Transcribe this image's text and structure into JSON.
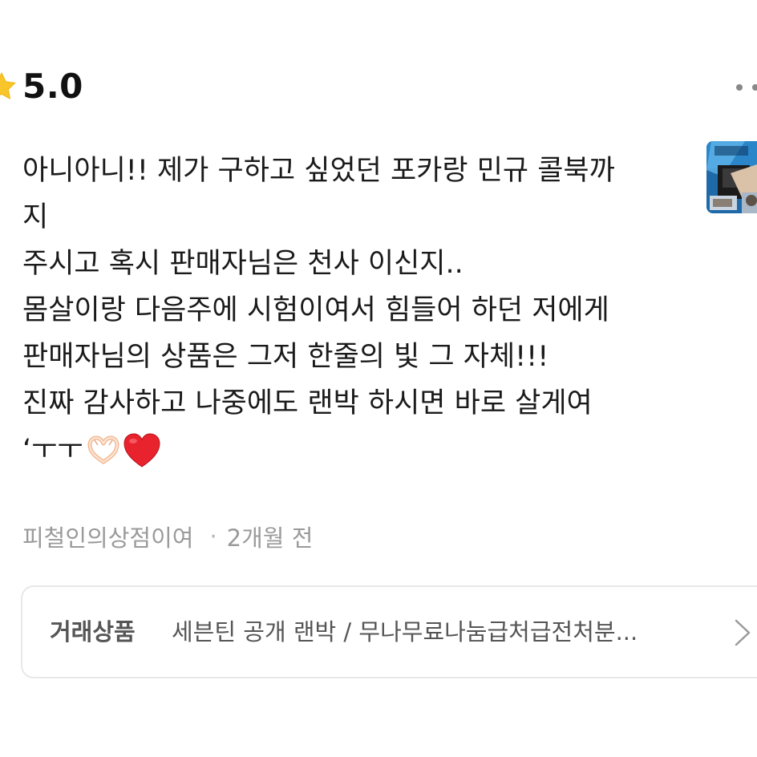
{
  "review": {
    "rating": "5.0",
    "lines": [
      "아니아니!! 제가 구하고 싶었던 포카랑 민규 콜북까",
      "지",
      "주시고 혹시 판매자님은 천사 이신지..",
      "몸살이랑 다음주에 시험이여서 힘들어 하던 저에게",
      "판매자님의 상품은 그저 한줄의 빛 그 자체!!!",
      "진짜 감사하고 나중에도 랜박 하시면 바로 살게여"
    ],
    "last_line_text": "‘ㅜㅜ",
    "last_line_icons": [
      "heart-hands-icon",
      "red-heart-icon"
    ],
    "reviewer": "피철인의상점이여",
    "time_ago": "2개월 전",
    "separator": "·"
  },
  "product": {
    "tag": "거래상품",
    "name": "세븐틴 공개 랜박 / 무나무료나눔급처급전처분..."
  },
  "icons": {
    "rating": "star-icon",
    "menu": "more-dots-icon",
    "card": "chevron-right-icon"
  },
  "colors": {
    "star": "#f8c52a",
    "text": "#1a1a1a",
    "meta": "#9a9a9a",
    "card_border": "#e8e8e8",
    "heart": "#e8232d",
    "hands": "#f6d3b8"
  }
}
